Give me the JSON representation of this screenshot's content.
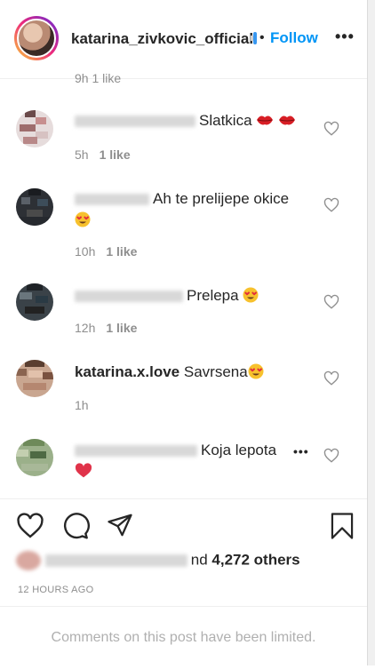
{
  "header": {
    "username": "katarina_zivkovic_official",
    "separator": "•",
    "follow_label": "Follow",
    "more_icon": "•••"
  },
  "cutoff_meta": "9h   1 like",
  "comments": [
    {
      "username": "",
      "text": "Slatkica",
      "emoji": "lips-emoji",
      "time": "5h",
      "likes": "1 like"
    },
    {
      "username": "",
      "text": "Ah te prelijepe okice",
      "emoji": "heart-eyes-emoji",
      "time": "10h",
      "likes": "1 like"
    },
    {
      "username": "",
      "text": "Prelepa",
      "emoji": "heart-eyes-emoji",
      "time": "12h",
      "likes": "1 like"
    },
    {
      "username": "katarina.x.love",
      "text": "Savrsena",
      "emoji": "heart-eyes-emoji",
      "time": "1h",
      "likes": ""
    },
    {
      "username": "",
      "text": "Koja lepota",
      "emoji": "red-heart-emoji",
      "time": "",
      "likes": "",
      "more": "•••"
    }
  ],
  "likes": {
    "suffix": "nd",
    "count": "4,272 others"
  },
  "time_ago": "12 HOURS AGO",
  "limited_notice": "Comments on this post have been limited.",
  "colors": {
    "accent": "#0095f6",
    "muted": "#8e8e8e",
    "text": "#262626",
    "heart_red": "#ed4956"
  }
}
